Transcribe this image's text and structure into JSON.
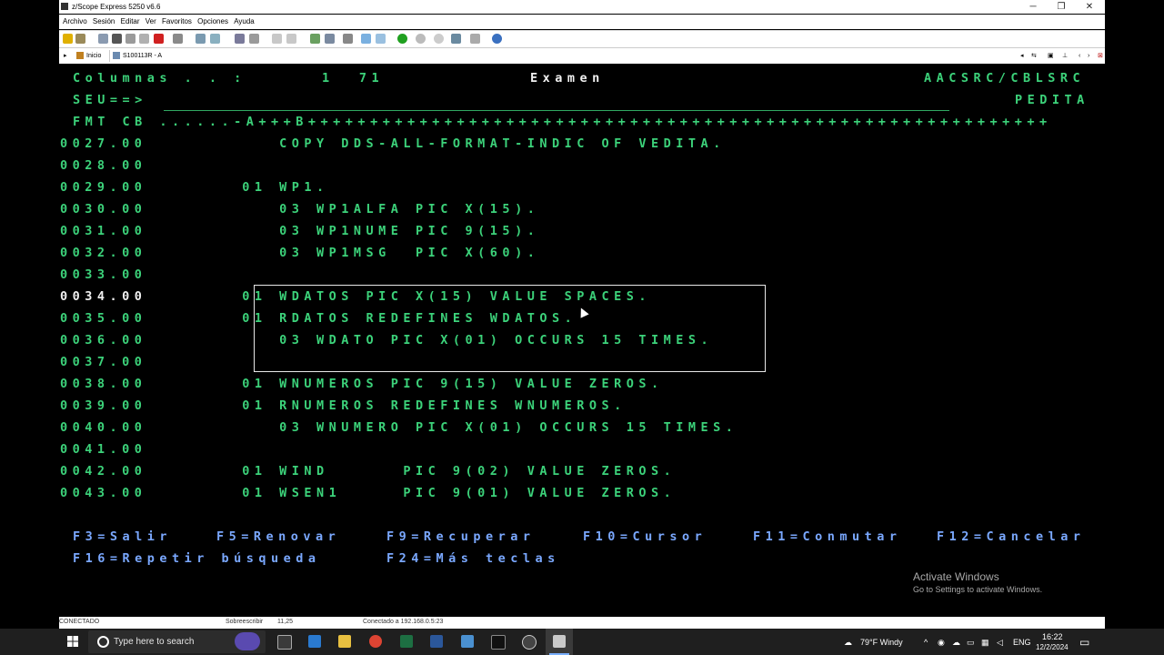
{
  "window": {
    "title": "z/Scope Express 5250 v6.6",
    "minimize": "─",
    "restore": "❐",
    "close": "✕"
  },
  "menu": [
    "Archivo",
    "Sesión",
    "Editar",
    "Ver",
    "Favoritos",
    "Opciones",
    "Ayuda"
  ],
  "session_bar": {
    "home_label": "Inicio",
    "session_label": "S100113R - A"
  },
  "screen": {
    "header": {
      "columnas_label": "Columnas . . :",
      "columnas_value": "1  71",
      "mode": "Examen",
      "file": "AACSRC/CBLSRC",
      "seu_prompt": "SEU==>",
      "member": "PEDITA",
      "ruler": "FMT CB ......-A+++B++++++++++++++++++++++++++++++++++++++++++++++++++++++++++++"
    },
    "lines": [
      {
        "seq": "0027.00",
        "text": "     COPY DDS-ALL-FORMAT-INDIC OF VEDITA."
      },
      {
        "seq": "0028.00",
        "text": ""
      },
      {
        "seq": "0029.00",
        "text": "  01 WP1."
      },
      {
        "seq": "0030.00",
        "text": "     03 WP1ALFA PIC X(15)."
      },
      {
        "seq": "0031.00",
        "text": "     03 WP1NUME PIC 9(15)."
      },
      {
        "seq": "0032.00",
        "text": "     03 WP1MSG  PIC X(60)."
      },
      {
        "seq": "0033.00",
        "text": ""
      },
      {
        "seq": "0034.00",
        "text": "  01 WDATOS PIC X(15) VALUE SPACES."
      },
      {
        "seq": "0035.00",
        "text": "  01 RDATOS REDEFINES WDATOS."
      },
      {
        "seq": "0036.00",
        "text": "     03 WDATO PIC X(01) OCCURS 15 TIMES."
      },
      {
        "seq": "0037.00",
        "text": ""
      },
      {
        "seq": "0038.00",
        "text": "  01 WNUMEROS PIC 9(15) VALUE ZEROS."
      },
      {
        "seq": "0039.00",
        "text": "  01 RNUMEROS REDEFINES WNUMEROS."
      },
      {
        "seq": "0040.00",
        "text": "     03 WNUMERO PIC X(01) OCCURS 15 TIMES."
      },
      {
        "seq": "0041.00",
        "text": ""
      },
      {
        "seq": "0042.00",
        "text": "  01 WIND      PIC 9(02) VALUE ZEROS."
      },
      {
        "seq": "0043.00",
        "text": "  01 WSEN1     PIC 9(01) VALUE ZEROS."
      }
    ],
    "fkeys_row1": [
      {
        "key": "F3=Salir"
      },
      {
        "key": "F5=Renovar"
      },
      {
        "key": "F9=Recuperar"
      },
      {
        "key": "F10=Cursor"
      },
      {
        "key": "F11=Conmutar"
      },
      {
        "key": "F12=Cancelar"
      }
    ],
    "fkeys_row2": [
      {
        "key": "F16=Repetir búsqueda"
      },
      {
        "key": "F24=Más teclas"
      }
    ],
    "watermark": {
      "line1": "Activate Windows",
      "line2": "Go to Settings to activate Windows."
    }
  },
  "statusbar": {
    "state": "CONECTADO",
    "mode": "Sobreescribir",
    "cursor": "11,25",
    "connection": "Conectado a 192.168.0.5:23"
  },
  "taskbar": {
    "search_placeholder": "Type here to search",
    "weather": "79°F  Windy",
    "language": "ENG",
    "time": "16:22",
    "date": "12/2/2024"
  },
  "colors": {
    "terminal_green": "#3cd27a",
    "terminal_blue": "#7aa8ff",
    "terminal_white": "#f0f0f0"
  }
}
